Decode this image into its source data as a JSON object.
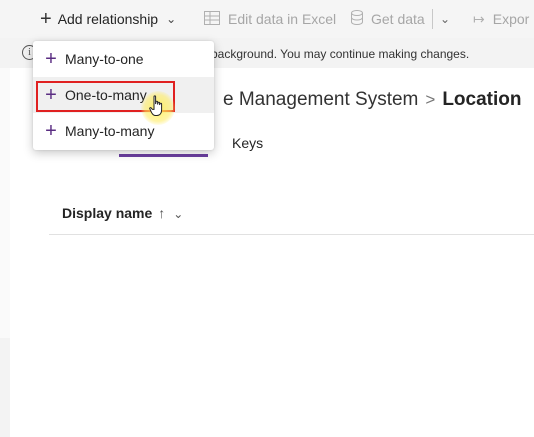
{
  "toolbar": {
    "add_relationship": "Add relationship",
    "edit_in_excel": "Edit data in Excel",
    "get_data": "Get data",
    "export": "Expor"
  },
  "infobar": {
    "text": "background. You may continue making changes."
  },
  "breadcrumb": {
    "parent": "e Management System",
    "separator": ">",
    "current": "Location"
  },
  "tabs": {
    "keys": "Keys"
  },
  "table": {
    "column_display_name": "Display name",
    "sort_arrow": "↑"
  },
  "menu": {
    "items": [
      {
        "label": "Many-to-one",
        "icon": "plus-icon"
      },
      {
        "label": "One-to-many",
        "icon": "plus-icon"
      },
      {
        "label": "Many-to-many",
        "icon": "plus-icon"
      }
    ]
  },
  "colors": {
    "accent": "#6b3fa0",
    "highlight_border": "#e02020",
    "cursor_glow": "#fff050"
  }
}
